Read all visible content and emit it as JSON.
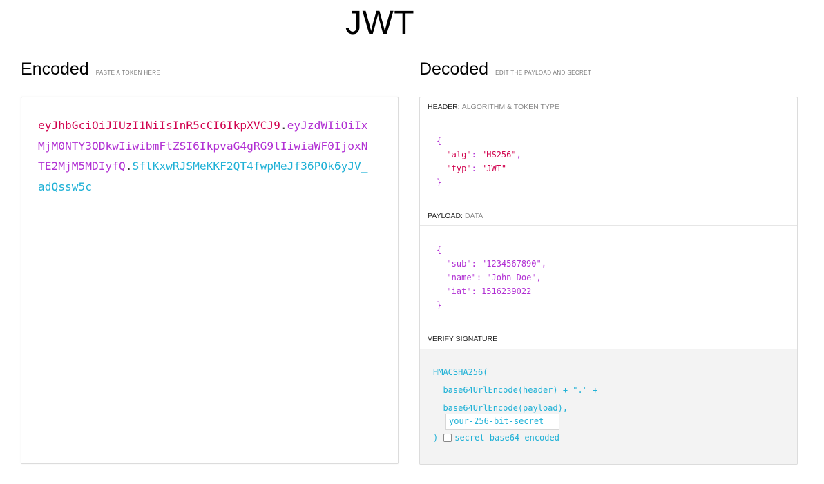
{
  "title": "JWT",
  "encoded": {
    "heading": "Encoded",
    "subheading": "PASTE A TOKEN HERE",
    "token_header": "eyJhbGciOiJIUzI1NiIsInR5cCI6IkpXVCJ9",
    "token_payload": "eyJzdWIiOiIxMjM0NTY3ODkwIiwibmFtZSI6IkpvaG4gRG9lIiwiaWF0IjoxNTE2MjM5MDIyfQ",
    "token_signature": "SflKxwRJSMeKKF2QT4fwpMeJf36POk6yJV_adQssw5c",
    "dot": "."
  },
  "decoded": {
    "heading": "Decoded",
    "subheading": "EDIT THE PAYLOAD AND SECRET",
    "header_label": "HEADER:",
    "header_label_muted": "ALGORITHM & TOKEN TYPE",
    "header_json": {
      "open": "{",
      "alg_key": "\"alg\"",
      "alg_value": "\"HS256\"",
      "typ_key": "\"typ\"",
      "typ_value": "\"JWT\"",
      "close": "}"
    },
    "payload_label": "PAYLOAD:",
    "payload_label_muted": "DATA",
    "payload_json": {
      "open": "{",
      "sub_key": "\"sub\"",
      "sub_value": "\"1234567890\"",
      "name_key": "\"name\"",
      "name_value": "\"John Doe\"",
      "iat_key": "\"iat\"",
      "iat_value": "1516239022",
      "close": "}"
    },
    "verify_label": "VERIFY SIGNATURE",
    "verify": {
      "line1": "HMACSHA256(",
      "line2": "  base64UrlEncode(header) + \".\" +",
      "line3": "  base64UrlEncode(payload),",
      "secret_value": "your-256-bit-secret",
      "close_paren": ")",
      "checkbox_label": "secret base64 encoded",
      "checkbox_checked": false
    }
  },
  "colors": {
    "header": "#d1024e",
    "payload": "#b12fd3",
    "signature": "#1fb1d6"
  }
}
